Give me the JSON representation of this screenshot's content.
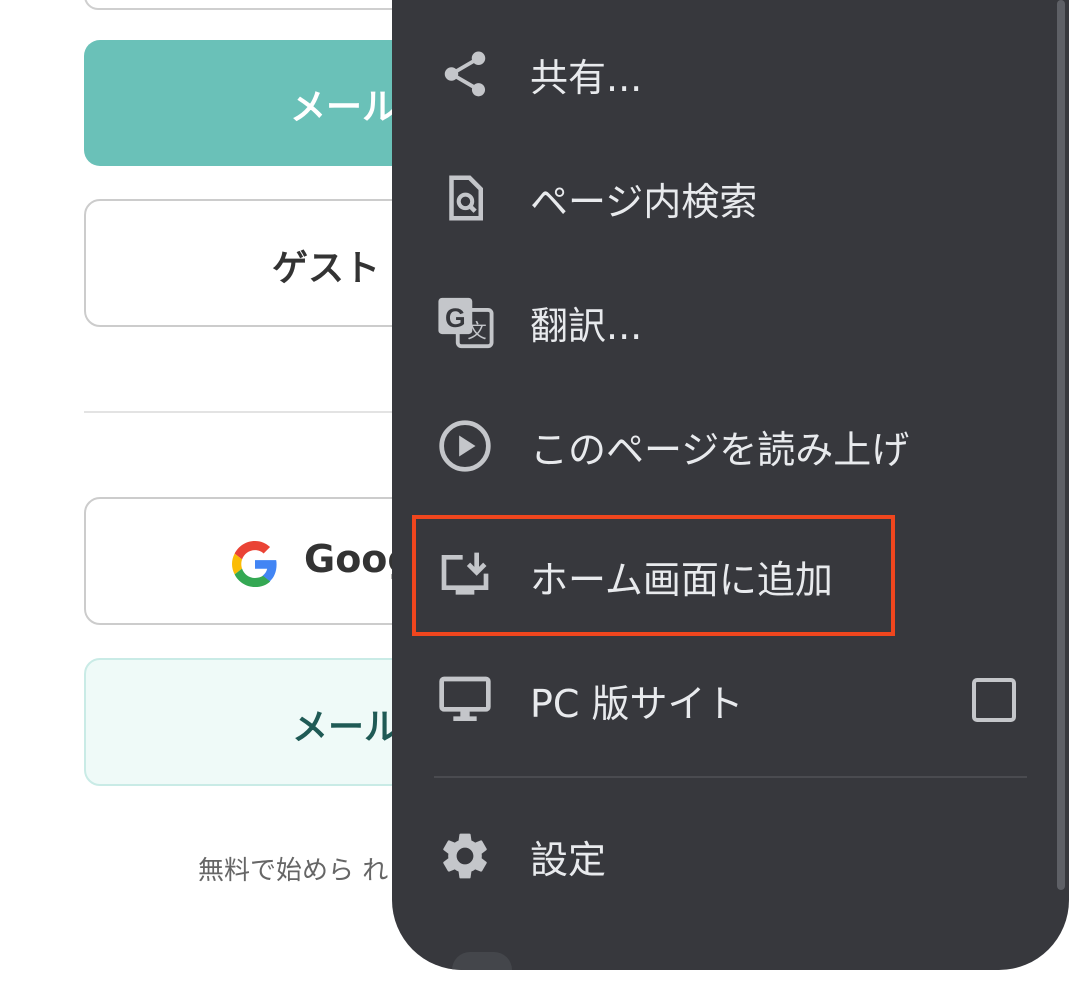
{
  "background_page": {
    "mail_login_button": "メール",
    "guest_button": "ゲスト",
    "google_button": "Goog",
    "mail_register_button": "メール",
    "footer_note": "無料で始めら れ"
  },
  "menu": {
    "items": [
      {
        "label": "共有...",
        "icon": "share-icon"
      },
      {
        "label": "ページ内検索",
        "icon": "find-in-page-icon"
      },
      {
        "label": "翻訳...",
        "icon": "translate-icon"
      },
      {
        "label": "このページを読み上げ",
        "icon": "play-circle-icon"
      },
      {
        "label": "ホーム画面に追加",
        "icon": "add-to-home-icon",
        "highlighted": true
      },
      {
        "label": "PC 版サイト",
        "icon": "desktop-icon",
        "checkbox": false
      },
      {
        "label": "設定",
        "icon": "gear-icon"
      }
    ]
  },
  "colors": {
    "menu_bg": "#37383d",
    "menu_text": "#e8eaed",
    "highlight": "#f0461e",
    "primary_button": "#6ac1b8"
  }
}
